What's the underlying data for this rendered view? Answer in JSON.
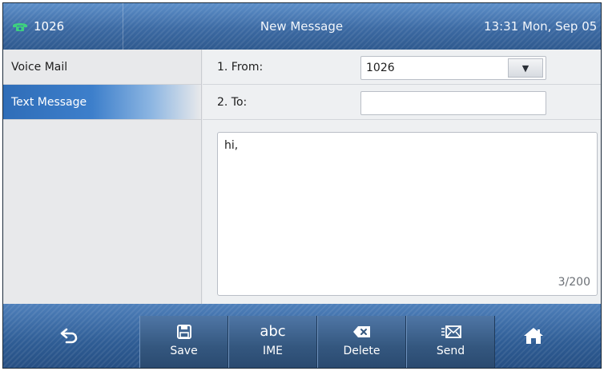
{
  "status_bar": {
    "account": "1026",
    "title": "New Message",
    "datetime": "13:31 Mon, Sep 05"
  },
  "sidebar": {
    "items": [
      {
        "label": "Voice Mail",
        "active": false
      },
      {
        "label": "Text Message",
        "active": true
      }
    ]
  },
  "form": {
    "from_label": "1. From:",
    "from_value": "1026",
    "to_label": "2. To:",
    "to_value": ""
  },
  "message": {
    "text": "hi,",
    "char_count": "3/200"
  },
  "softkeys": {
    "back_icon": "back-arrow-icon",
    "items": [
      {
        "label": "Save",
        "icon": "save-icon"
      },
      {
        "label": "IME",
        "icon": "abc",
        "glyph": "abc"
      },
      {
        "label": "Delete",
        "icon": "backspace-icon"
      },
      {
        "label": "Send",
        "icon": "send-envelope-icon"
      }
    ],
    "home_icon": "home-icon"
  },
  "colors": {
    "status_bar": "#3e6fa8",
    "active_item": "#2f6db8",
    "softkey_bar": "#2f5d95",
    "phone_icon": "#37c37a"
  }
}
